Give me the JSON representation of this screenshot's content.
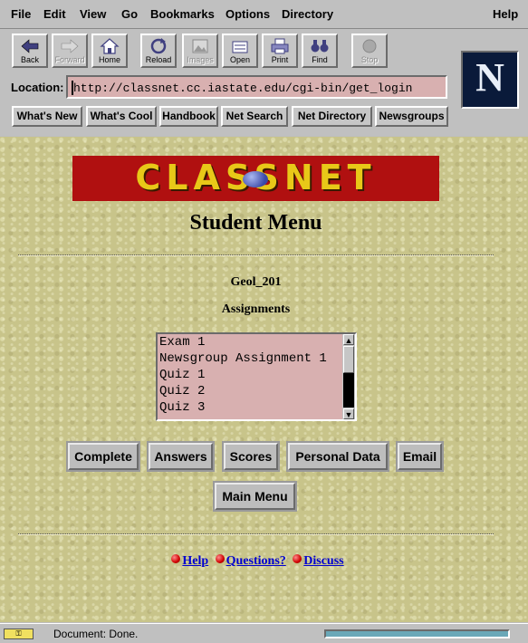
{
  "menu": {
    "file": "File",
    "edit": "Edit",
    "view": "View",
    "go": "Go",
    "bookmarks": "Bookmarks",
    "options": "Options",
    "directory": "Directory",
    "help": "Help"
  },
  "toolbar": {
    "back": "Back",
    "forward": "Forward",
    "home": "Home",
    "reload": "Reload",
    "images": "Images",
    "open": "Open",
    "print": "Print",
    "find": "Find",
    "stop": "Stop"
  },
  "location": {
    "label": "Location:",
    "url": "http://classnet.cc.iastate.edu/cgi-bin/get_login"
  },
  "directory_buttons": [
    "What's New",
    "What's Cool",
    "Handbook",
    "Net Search",
    "Net Directory",
    "Newsgroups"
  ],
  "logo_letter": "N",
  "page": {
    "banner": "CLASSNET",
    "title": "Student Menu",
    "course": "Geol_201",
    "section": "Assignments",
    "assignments": [
      "Exam 1",
      "Newsgroup Assignment 1",
      "Quiz 1",
      "Quiz 2",
      "Quiz 3"
    ],
    "buttons": {
      "complete": "Complete",
      "answers": "Answers",
      "scores": "Scores",
      "personal_data": "Personal Data",
      "email": "Email",
      "main_menu": "Main Menu"
    },
    "links": {
      "help": "Help",
      "questions": "Questions?",
      "discuss": "Discuss"
    }
  },
  "status": {
    "text": "Document: Done."
  },
  "colors": {
    "field_bg": "#d8b0b0",
    "banner_bg": "#b01010",
    "banner_text": "#e8c818",
    "link": "#0000d0"
  }
}
